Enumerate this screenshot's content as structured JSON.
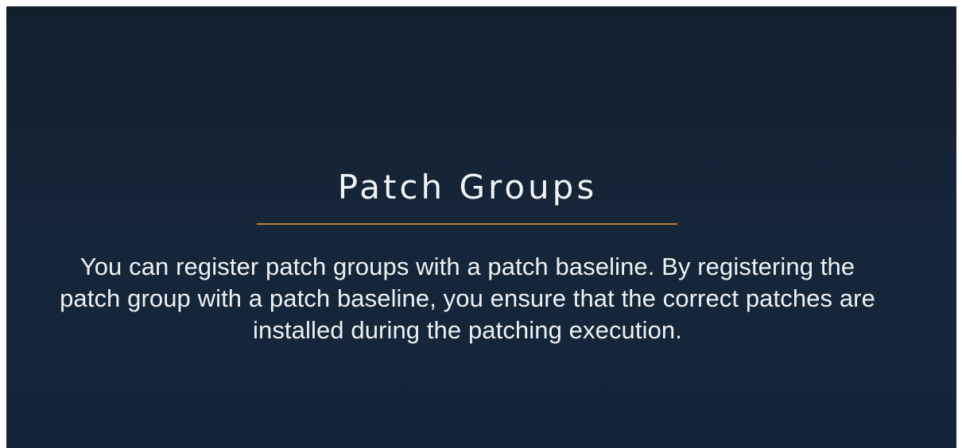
{
  "slide": {
    "title": "Patch Groups",
    "body": "You can register patch groups with a patch baseline. By registering the patch group with a patch baseline, you ensure that the correct patches are installed during the patching execution.",
    "colors": {
      "background": "#14243a",
      "accent_line": "#b8862c",
      "text": "#eef1f4"
    }
  }
}
